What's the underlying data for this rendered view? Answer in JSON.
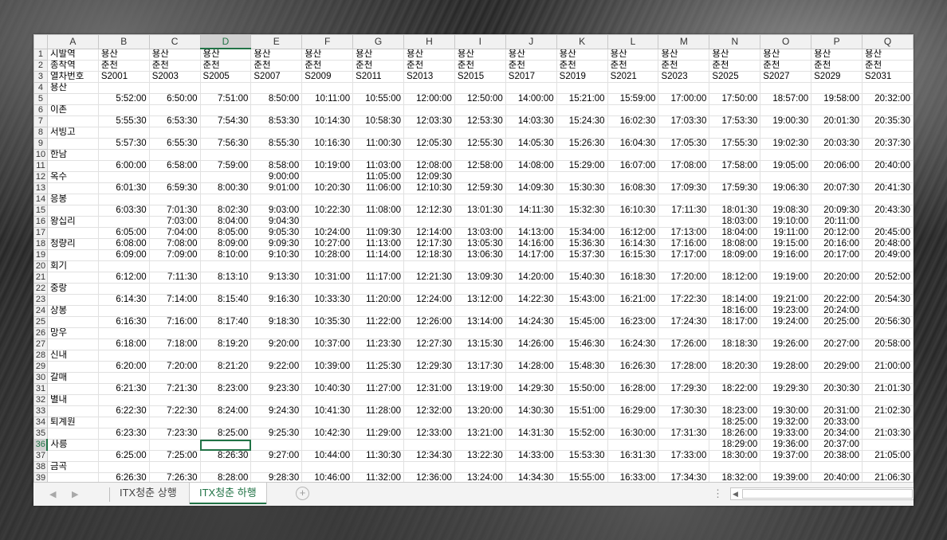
{
  "spreadsheet": {
    "columns": [
      "A",
      "B",
      "C",
      "D",
      "E",
      "F",
      "G",
      "H",
      "I",
      "J",
      "K",
      "L",
      "M",
      "N",
      "O",
      "P",
      "Q"
    ],
    "selected_column": "D",
    "selected_row": 36,
    "rows": [
      {
        "n": 1,
        "cells": [
          "시발역",
          "용산",
          "용산",
          "용산",
          "용산",
          "용산",
          "용산",
          "용산",
          "용산",
          "용산",
          "용산",
          "용산",
          "용산",
          "용산",
          "용산",
          "용산",
          "용산"
        ]
      },
      {
        "n": 2,
        "cells": [
          "종착역",
          "춘천",
          "춘천",
          "춘천",
          "춘천",
          "춘천",
          "춘천",
          "춘천",
          "춘천",
          "춘천",
          "춘천",
          "춘천",
          "춘천",
          "춘천",
          "춘천",
          "춘천",
          "춘천"
        ]
      },
      {
        "n": 3,
        "cells": [
          "열차번호",
          "S2001",
          "S2003",
          "S2005",
          "S2007",
          "S2009",
          "S2011",
          "S2013",
          "S2015",
          "S2017",
          "S2019",
          "S2021",
          "S2023",
          "S2025",
          "S2027",
          "S2029",
          "S2031"
        ]
      },
      {
        "n": 4,
        "cells": [
          "용산",
          "",
          "",
          "",
          "",
          "",
          "",
          "",
          "",
          "",
          "",
          "",
          "",
          "",
          "",
          "",
          ""
        ]
      },
      {
        "n": 5,
        "cells": [
          "",
          "5:52:00",
          "6:50:00",
          "7:51:00",
          "8:50:00",
          "10:11:00",
          "10:55:00",
          "12:00:00",
          "12:50:00",
          "14:00:00",
          "15:21:00",
          "15:59:00",
          "17:00:00",
          "17:50:00",
          "18:57:00",
          "19:58:00",
          "20:32:00"
        ]
      },
      {
        "n": 6,
        "cells": [
          "이촌",
          "",
          "",
          "",
          "",
          "",
          "",
          "",
          "",
          "",
          "",
          "",
          "",
          "",
          "",
          "",
          ""
        ]
      },
      {
        "n": 7,
        "cells": [
          "",
          "5:55:30",
          "6:53:30",
          "7:54:30",
          "8:53:30",
          "10:14:30",
          "10:58:30",
          "12:03:30",
          "12:53:30",
          "14:03:30",
          "15:24:30",
          "16:02:30",
          "17:03:30",
          "17:53:30",
          "19:00:30",
          "20:01:30",
          "20:35:30"
        ]
      },
      {
        "n": 8,
        "cells": [
          "서빙고",
          "",
          "",
          "",
          "",
          "",
          "",
          "",
          "",
          "",
          "",
          "",
          "",
          "",
          "",
          "",
          ""
        ]
      },
      {
        "n": 9,
        "cells": [
          "",
          "5:57:30",
          "6:55:30",
          "7:56:30",
          "8:55:30",
          "10:16:30",
          "11:00:30",
          "12:05:30",
          "12:55:30",
          "14:05:30",
          "15:26:30",
          "16:04:30",
          "17:05:30",
          "17:55:30",
          "19:02:30",
          "20:03:30",
          "20:37:30"
        ]
      },
      {
        "n": 10,
        "cells": [
          "한남",
          "",
          "",
          "",
          "",
          "",
          "",
          "",
          "",
          "",
          "",
          "",
          "",
          "",
          "",
          "",
          ""
        ]
      },
      {
        "n": 11,
        "cells": [
          "",
          "6:00:00",
          "6:58:00",
          "7:59:00",
          "8:58:00",
          "10:19:00",
          "11:03:00",
          "12:08:00",
          "12:58:00",
          "14:08:00",
          "15:29:00",
          "16:07:00",
          "17:08:00",
          "17:58:00",
          "19:05:00",
          "20:06:00",
          "20:40:00"
        ]
      },
      {
        "n": 12,
        "cells": [
          "옥수",
          "",
          "",
          "",
          "9:00:00",
          "",
          "11:05:00",
          "12:09:30",
          "",
          "",
          "",
          "",
          "",
          "",
          "",
          "",
          ""
        ]
      },
      {
        "n": 13,
        "cells": [
          "",
          "6:01:30",
          "6:59:30",
          "8:00:30",
          "9:01:00",
          "10:20:30",
          "11:06:00",
          "12:10:30",
          "12:59:30",
          "14:09:30",
          "15:30:30",
          "16:08:30",
          "17:09:30",
          "17:59:30",
          "19:06:30",
          "20:07:30",
          "20:41:30"
        ]
      },
      {
        "n": 14,
        "cells": [
          "응봉",
          "",
          "",
          "",
          "",
          "",
          "",
          "",
          "",
          "",
          "",
          "",
          "",
          "",
          "",
          "",
          ""
        ]
      },
      {
        "n": 15,
        "cells": [
          "",
          "6:03:30",
          "7:01:30",
          "8:02:30",
          "9:03:00",
          "10:22:30",
          "11:08:00",
          "12:12:30",
          "13:01:30",
          "14:11:30",
          "15:32:30",
          "16:10:30",
          "17:11:30",
          "18:01:30",
          "19:08:30",
          "20:09:30",
          "20:43:30"
        ]
      },
      {
        "n": 16,
        "cells": [
          "왕십리",
          "",
          "7:03:00",
          "8:04:00",
          "9:04:30",
          "",
          "",
          "",
          "",
          "",
          "",
          "",
          "",
          "18:03:00",
          "19:10:00",
          "20:11:00",
          ""
        ]
      },
      {
        "n": 17,
        "cells": [
          "",
          "6:05:00",
          "7:04:00",
          "8:05:00",
          "9:05:30",
          "10:24:00",
          "11:09:30",
          "12:14:00",
          "13:03:00",
          "14:13:00",
          "15:34:00",
          "16:12:00",
          "17:13:00",
          "18:04:00",
          "19:11:00",
          "20:12:00",
          "20:45:00"
        ]
      },
      {
        "n": 18,
        "cells": [
          "청량리",
          "6:08:00",
          "7:08:00",
          "8:09:00",
          "9:09:30",
          "10:27:00",
          "11:13:00",
          "12:17:30",
          "13:05:30",
          "14:16:00",
          "15:36:30",
          "16:14:30",
          "17:16:00",
          "18:08:00",
          "19:15:00",
          "20:16:00",
          "20:48:00"
        ]
      },
      {
        "n": 19,
        "cells": [
          "",
          "6:09:00",
          "7:09:00",
          "8:10:00",
          "9:10:30",
          "10:28:00",
          "11:14:00",
          "12:18:30",
          "13:06:30",
          "14:17:00",
          "15:37:30",
          "16:15:30",
          "17:17:00",
          "18:09:00",
          "19:16:00",
          "20:17:00",
          "20:49:00"
        ]
      },
      {
        "n": 20,
        "cells": [
          "회기",
          "",
          "",
          "",
          "",
          "",
          "",
          "",
          "",
          "",
          "",
          "",
          "",
          "",
          "",
          "",
          ""
        ]
      },
      {
        "n": 21,
        "cells": [
          "",
          "6:12:00",
          "7:11:30",
          "8:13:10",
          "9:13:30",
          "10:31:00",
          "11:17:00",
          "12:21:30",
          "13:09:30",
          "14:20:00",
          "15:40:30",
          "16:18:30",
          "17:20:00",
          "18:12:00",
          "19:19:00",
          "20:20:00",
          "20:52:00"
        ]
      },
      {
        "n": 22,
        "cells": [
          "중랑",
          "",
          "",
          "",
          "",
          "",
          "",
          "",
          "",
          "",
          "",
          "",
          "",
          "",
          "",
          "",
          ""
        ]
      },
      {
        "n": 23,
        "cells": [
          "",
          "6:14:30",
          "7:14:00",
          "8:15:40",
          "9:16:30",
          "10:33:30",
          "11:20:00",
          "12:24:00",
          "13:12:00",
          "14:22:30",
          "15:43:00",
          "16:21:00",
          "17:22:30",
          "18:14:00",
          "19:21:00",
          "20:22:00",
          "20:54:30"
        ]
      },
      {
        "n": 24,
        "cells": [
          "상봉",
          "",
          "",
          "",
          "",
          "",
          "",
          "",
          "",
          "",
          "",
          "",
          "",
          "18:16:00",
          "19:23:00",
          "20:24:00",
          ""
        ]
      },
      {
        "n": 25,
        "cells": [
          "",
          "6:16:30",
          "7:16:00",
          "8:17:40",
          "9:18:30",
          "10:35:30",
          "11:22:00",
          "12:26:00",
          "13:14:00",
          "14:24:30",
          "15:45:00",
          "16:23:00",
          "17:24:30",
          "18:17:00",
          "19:24:00",
          "20:25:00",
          "20:56:30"
        ]
      },
      {
        "n": 26,
        "cells": [
          "망우",
          "",
          "",
          "",
          "",
          "",
          "",
          "",
          "",
          "",
          "",
          "",
          "",
          "",
          "",
          "",
          ""
        ]
      },
      {
        "n": 27,
        "cells": [
          "",
          "6:18:00",
          "7:18:00",
          "8:19:20",
          "9:20:00",
          "10:37:00",
          "11:23:30",
          "12:27:30",
          "13:15:30",
          "14:26:00",
          "15:46:30",
          "16:24:30",
          "17:26:00",
          "18:18:30",
          "19:26:00",
          "20:27:00",
          "20:58:00"
        ]
      },
      {
        "n": 28,
        "cells": [
          "신내",
          "",
          "",
          "",
          "",
          "",
          "",
          "",
          "",
          "",
          "",
          "",
          "",
          "",
          "",
          "",
          ""
        ]
      },
      {
        "n": 29,
        "cells": [
          "",
          "6:20:00",
          "7:20:00",
          "8:21:20",
          "9:22:00",
          "10:39:00",
          "11:25:30",
          "12:29:30",
          "13:17:30",
          "14:28:00",
          "15:48:30",
          "16:26:30",
          "17:28:00",
          "18:20:30",
          "19:28:00",
          "20:29:00",
          "21:00:00"
        ]
      },
      {
        "n": 30,
        "cells": [
          "갈매",
          "",
          "",
          "",
          "",
          "",
          "",
          "",
          "",
          "",
          "",
          "",
          "",
          "",
          "",
          "",
          ""
        ]
      },
      {
        "n": 31,
        "cells": [
          "",
          "6:21:30",
          "7:21:30",
          "8:23:00",
          "9:23:30",
          "10:40:30",
          "11:27:00",
          "12:31:00",
          "13:19:00",
          "14:29:30",
          "15:50:00",
          "16:28:00",
          "17:29:30",
          "18:22:00",
          "19:29:30",
          "20:30:30",
          "21:01:30"
        ]
      },
      {
        "n": 32,
        "cells": [
          "별내",
          "",
          "",
          "",
          "",
          "",
          "",
          "",
          "",
          "",
          "",
          "",
          "",
          "",
          "",
          "",
          ""
        ]
      },
      {
        "n": 33,
        "cells": [
          "",
          "6:22:30",
          "7:22:30",
          "8:24:00",
          "9:24:30",
          "10:41:30",
          "11:28:00",
          "12:32:00",
          "13:20:00",
          "14:30:30",
          "15:51:00",
          "16:29:00",
          "17:30:30",
          "18:23:00",
          "19:30:00",
          "20:31:00",
          "21:02:30"
        ]
      },
      {
        "n": 34,
        "cells": [
          "퇴계원",
          "",
          "",
          "",
          "",
          "",
          "",
          "",
          "",
          "",
          "",
          "",
          "",
          "18:25:00",
          "19:32:00",
          "20:33:00",
          ""
        ]
      },
      {
        "n": 35,
        "cells": [
          "",
          "6:23:30",
          "7:23:30",
          "8:25:00",
          "9:25:30",
          "10:42:30",
          "11:29:00",
          "12:33:00",
          "13:21:00",
          "14:31:30",
          "15:52:00",
          "16:30:00",
          "17:31:30",
          "18:26:00",
          "19:33:00",
          "20:34:00",
          "21:03:30"
        ]
      },
      {
        "n": 36,
        "cells": [
          "사릉",
          "",
          "",
          "",
          "",
          "",
          "",
          "",
          "",
          "",
          "",
          "",
          "",
          "18:29:00",
          "19:36:00",
          "20:37:00",
          ""
        ]
      },
      {
        "n": 37,
        "cells": [
          "",
          "6:25:00",
          "7:25:00",
          "8:26:30",
          "9:27:00",
          "10:44:00",
          "11:30:30",
          "12:34:30",
          "13:22:30",
          "14:33:00",
          "15:53:30",
          "16:31:30",
          "17:33:00",
          "18:30:00",
          "19:37:00",
          "20:38:00",
          "21:05:00"
        ]
      },
      {
        "n": 38,
        "cells": [
          "금곡",
          "",
          "",
          "",
          "",
          "",
          "",
          "",
          "",
          "",
          "",
          "",
          "",
          "",
          "",
          "",
          ""
        ]
      },
      {
        "n": 39,
        "cells": [
          "",
          "6:26:30",
          "7:26:30",
          "8:28:00",
          "9:28:30",
          "10:46:00",
          "11:32:00",
          "12:36:00",
          "13:24:00",
          "14:34:30",
          "15:55:00",
          "16:33:00",
          "17:34:30",
          "18:32:00",
          "19:39:00",
          "20:40:00",
          "21:06:30"
        ]
      }
    ]
  },
  "sheet_tabs": [
    {
      "label": "ITX청춘 상행",
      "active": false
    },
    {
      "label": "ITX청춘 하행",
      "active": true
    }
  ],
  "accent_color": "#217346"
}
